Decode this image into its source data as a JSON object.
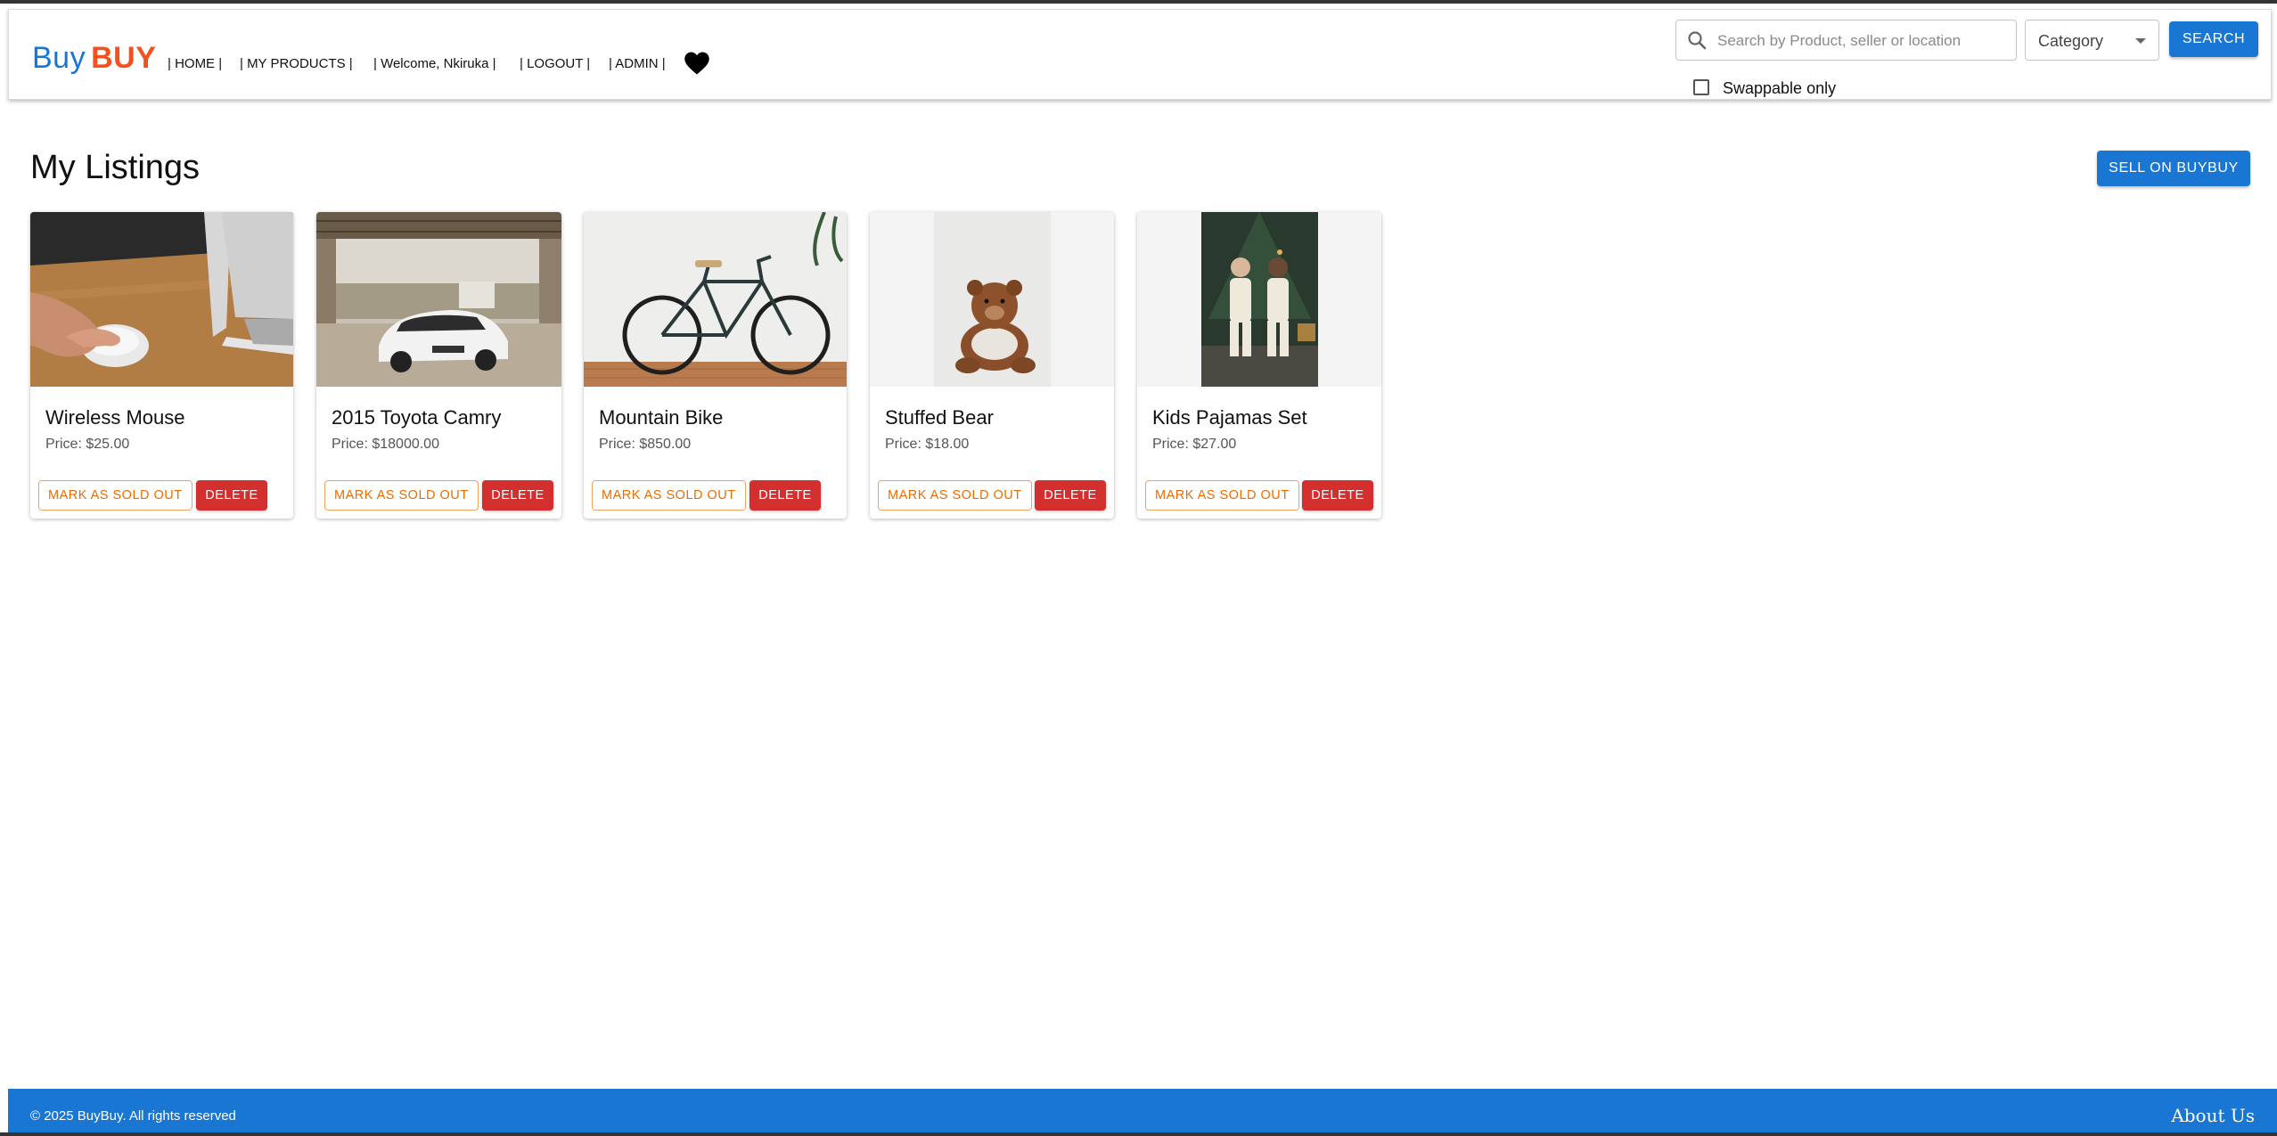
{
  "brand": {
    "part1": "Buy",
    "part2": "BUY",
    "colors": {
      "part1": "#1976d2",
      "part2": "#f4511e"
    }
  },
  "nav": {
    "home": "| HOME |",
    "my_products": "| MY PRODUCTS |",
    "welcome": "| Welcome, Nkiruka |",
    "logout": "| LOGOUT |",
    "admin": "| ADMIN |",
    "favorites_icon": "heart-icon"
  },
  "search": {
    "placeholder": "Search by Product, seller or location",
    "value": "",
    "category_label": "Category",
    "button_label": "SEARCH",
    "swappable_label": "Swappable only",
    "swappable_checked": false
  },
  "main": {
    "title": "My Listings",
    "sell_button": "SELL ON BUYBUY",
    "listings": [
      {
        "title": "Wireless Mouse",
        "price": "Price: $25.00",
        "sold_label": "MARK AS SOLD OUT",
        "delete_label": "DELETE"
      },
      {
        "title": "2015 Toyota Camry",
        "price": "Price: $18000.00",
        "sold_label": "MARK AS SOLD OUT",
        "delete_label": "DELETE"
      },
      {
        "title": "Mountain Bike",
        "price": "Price: $850.00",
        "sold_label": "MARK AS SOLD OUT",
        "delete_label": "DELETE"
      },
      {
        "title": "Stuffed Bear",
        "price": "Price: $18.00",
        "sold_label": "MARK AS SOLD OUT",
        "delete_label": "DELETE"
      },
      {
        "title": "Kids Pajamas Set",
        "price": "Price: $27.00",
        "sold_label": "MARK AS SOLD OUT",
        "delete_label": "DELETE"
      }
    ]
  },
  "footer": {
    "copyright": "© 2025 BuyBuy. All rights reserved",
    "about": "About Us"
  },
  "colors": {
    "primary": "#1976d2",
    "danger": "#d32f2f",
    "warning": "#ed6c02"
  }
}
